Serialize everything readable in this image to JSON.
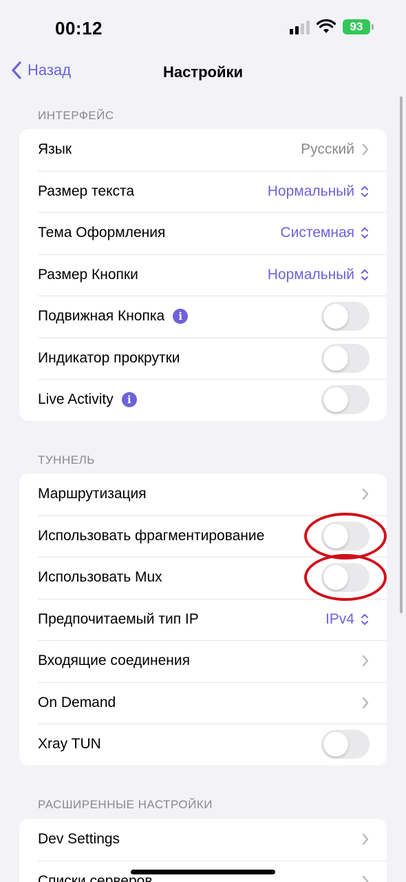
{
  "status_bar": {
    "time": "00:12",
    "battery": "93",
    "battery_color": "#34c759"
  },
  "nav": {
    "back_label": "Назад",
    "title": "Настройки"
  },
  "accent_color": "#6e62d9",
  "annotation_color": "#d0101a",
  "sections": [
    {
      "header": "ИНТЕРФЕЙС",
      "rows": [
        {
          "label": "Язык",
          "type": "link",
          "value": "Русский",
          "icon": "chevron-right-icon"
        },
        {
          "label": "Размер текста",
          "type": "picker",
          "value": "Нормальный",
          "icon": "chevron-up-down-icon"
        },
        {
          "label": "Тема Оформления",
          "type": "picker",
          "value": "Системная",
          "icon": "chevron-up-down-icon"
        },
        {
          "label": "Размер Кнопки",
          "type": "picker",
          "value": "Нормальный",
          "icon": "chevron-up-down-icon"
        },
        {
          "label": "Подвижная Кнопка",
          "type": "toggle",
          "on": false,
          "info": "i"
        },
        {
          "label": "Индикатор прокрутки",
          "type": "toggle",
          "on": false
        },
        {
          "label": "Live Activity",
          "type": "toggle",
          "on": false,
          "info": "i"
        }
      ]
    },
    {
      "header": "ТУННЕЛЬ",
      "rows": [
        {
          "label": "Маршрутизация",
          "type": "link",
          "icon": "chevron-right-icon"
        },
        {
          "label": "Использовать фрагментирование",
          "type": "toggle",
          "on": false,
          "annotated": true
        },
        {
          "label": "Использовать Mux",
          "type": "toggle",
          "on": false,
          "annotated": true
        },
        {
          "label": "Предпочитаемый тип IP",
          "type": "picker",
          "value": "IPv4",
          "icon": "chevron-up-down-icon"
        },
        {
          "label": "Входящие соединения",
          "type": "link",
          "icon": "chevron-right-icon"
        },
        {
          "label": "On Demand",
          "type": "link",
          "icon": "chevron-right-icon"
        },
        {
          "label": "Xray TUN",
          "type": "toggle",
          "on": false
        }
      ]
    },
    {
      "header": "РАСШИРЕННЫЕ НАСТРОЙКИ",
      "rows": [
        {
          "label": "Dev Settings",
          "type": "link",
          "icon": "chevron-right-icon"
        },
        {
          "label": "Списки серверов",
          "type": "link",
          "icon": "chevron-right-icon"
        }
      ]
    }
  ]
}
